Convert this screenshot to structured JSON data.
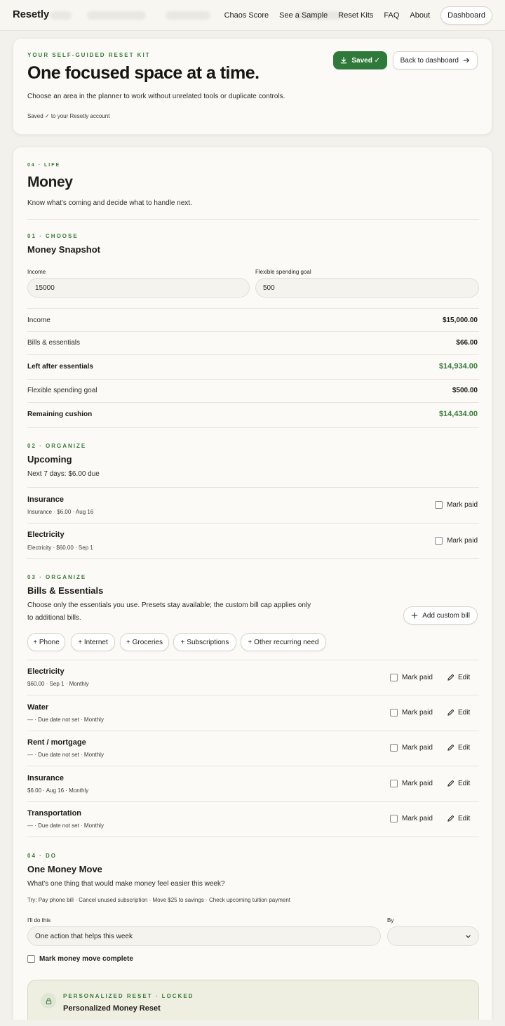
{
  "nav": {
    "brand": "Resetly",
    "links": [
      "Chaos Score",
      "See a Sample",
      "Reset Kits",
      "FAQ",
      "About"
    ],
    "dashboard": "Dashboard"
  },
  "header": {
    "eyebrow": "YOUR SELF-GUIDED RESET KIT",
    "title": "One focused space at a time.",
    "subtitle": "Choose an area in the planner to work without unrelated tools or duplicate controls.",
    "saved_note": "Saved ✓ to your Resetly account",
    "saved_button": "Saved ✓",
    "back_button": "Back to dashboard"
  },
  "section": {
    "eyebrow": "04 · LIFE",
    "title": "Money",
    "subtitle": "Know what's coming and decide what to handle next."
  },
  "snapshot": {
    "eyebrow": "01 · CHOOSE",
    "title": "Money Snapshot",
    "income_label": "Income",
    "income_value": "15000",
    "goal_label": "Flexible spending goal",
    "goal_value": "500",
    "rows": [
      {
        "label": "Income",
        "value": "$15,000.00"
      },
      {
        "label": "Bills & essentials",
        "value": "$66.00"
      },
      {
        "label": "Left after essentials",
        "value": "$14,934.00"
      },
      {
        "label": "Flexible spending goal",
        "value": "$500.00"
      },
      {
        "label": "Remaining cushion",
        "value": "$14,434.00"
      }
    ]
  },
  "upcoming": {
    "eyebrow": "02 · ORGANIZE",
    "title": "Upcoming",
    "summary": "Next 7 days: $6.00 due",
    "items": [
      {
        "title": "Insurance",
        "meta": "Insurance · $6.00 · Aug 16",
        "action": "Mark paid"
      },
      {
        "title": "Electricity",
        "meta": "Electricity · $60.00 · Sep 1",
        "action": "Mark paid"
      }
    ]
  },
  "bills": {
    "eyebrow": "03 · ORGANIZE",
    "title": "Bills & Essentials",
    "desc_line1": "Choose only the essentials you use. Presets stay available; the custom bill cap applies only",
    "desc_line2": "to additional bills.",
    "add_button": "Add custom bill",
    "chips": [
      "+ Phone",
      "+ Internet",
      "+ Groceries",
      "+ Subscriptions",
      "+ Other recurring need"
    ],
    "mark_label": "Mark paid",
    "edit_label": "Edit",
    "items": [
      {
        "title": "Electricity",
        "meta": "$60.00 · Sep 1 · Monthly"
      },
      {
        "title": "Water",
        "meta": "— · Due date not set · Monthly"
      },
      {
        "title": "Rent / mortgage",
        "meta": "— · Due date not set · Monthly"
      },
      {
        "title": "Insurance",
        "meta": "$6.00 · Aug 16 · Monthly"
      },
      {
        "title": "Transportation",
        "meta": "— · Due date not set · Monthly"
      }
    ]
  },
  "move": {
    "eyebrow": "04 · DO",
    "title": "One Money Move",
    "question": "What's one thing that would make money feel easier this week?",
    "tries": "Try: Pay phone bill · Cancel unused subscription · Move $25 to savings · Check upcoming tuition payment",
    "do_label": "I'll do this",
    "do_placeholder": "One action that helps this week",
    "by_label": "By",
    "complete_label": "Mark money move complete"
  },
  "locked": {
    "eyebrow": "PERSONALIZED RESET · LOCKED",
    "title": "Personalized Money Reset"
  },
  "colors": {
    "accent_green": "#2f7a3a",
    "page_bg": "#f2f1ec",
    "card_bg": "#fbfaf6"
  }
}
